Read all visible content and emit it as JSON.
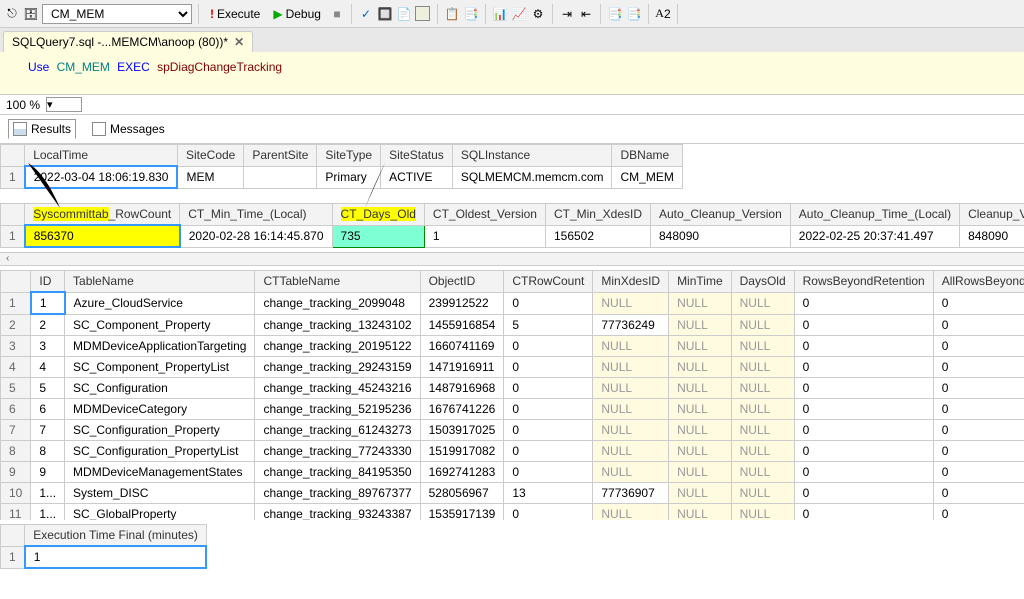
{
  "toolbar": {
    "database": "CM_MEM",
    "execute_label": "Execute",
    "debug_label": "Debug"
  },
  "tab": {
    "title": "SQLQuery7.sql -...MEMCM\\anoop (80))*"
  },
  "editor": {
    "use": "Use",
    "db": "CM_MEM",
    "exec": "EXEC",
    "proc": "spDiagChangeTracking"
  },
  "zoom": {
    "value": "100 %"
  },
  "result_tabs": {
    "results": "Results",
    "messages": "Messages"
  },
  "grid1": {
    "headers": [
      "LocalTime",
      "SiteCode",
      "ParentSite",
      "SiteType",
      "SiteStatus",
      "SQLInstance",
      "DBName"
    ],
    "row_num": "1",
    "row": [
      "2022-03-04 18:06:19.830",
      "MEM",
      "",
      "Primary",
      "ACTIVE",
      "SQLMEMCM.memcm.com",
      "CM_MEM"
    ]
  },
  "grid2": {
    "headers": [
      "Syscommittab_RowCount",
      "CT_Min_Time_(Local)",
      "CT_Days_Old",
      "CT_Oldest_Version",
      "CT_Min_XdesID",
      "Auto_Cleanup_Version",
      "Auto_Cleanup_Time_(Local)",
      "Cleanup_Version"
    ],
    "header_parts": {
      "h0_a": "Syscommittab",
      "h0_b": "_RowCount"
    },
    "row_num": "1",
    "row": [
      "856370",
      "2020-02-28 16:14:45.870",
      "735",
      "1",
      "156502",
      "848090",
      "2022-02-25 20:37:41.497",
      "848090"
    ]
  },
  "grid3": {
    "headers": [
      "ID",
      "TableName",
      "CTTableName",
      "ObjectID",
      "CTRowCount",
      "MinXdesID",
      "MinTime",
      "DaysOld",
      "RowsBeyondRetention",
      "AllRowsBeyondRetention"
    ],
    "rows": [
      {
        "n": "1",
        "id": "1",
        "tn": "Azure_CloudService",
        "ct": "change_tracking_2099048",
        "oid": "239912522",
        "crc": "0",
        "mx": "NULL",
        "mt": "NULL",
        "do": "NULL",
        "rb": "0",
        "ar": "0"
      },
      {
        "n": "2",
        "id": "2",
        "tn": "SC_Component_Property",
        "ct": "change_tracking_13243102",
        "oid": "1455916854",
        "crc": "5",
        "mx": "77736249",
        "mt": "NULL",
        "do": "NULL",
        "rb": "0",
        "ar": "0"
      },
      {
        "n": "3",
        "id": "3",
        "tn": "MDMDeviceApplicationTargeting",
        "ct": "change_tracking_20195122",
        "oid": "1660741169",
        "crc": "0",
        "mx": "NULL",
        "mt": "NULL",
        "do": "NULL",
        "rb": "0",
        "ar": "0"
      },
      {
        "n": "4",
        "id": "4",
        "tn": "SC_Component_PropertyList",
        "ct": "change_tracking_29243159",
        "oid": "1471916911",
        "crc": "0",
        "mx": "NULL",
        "mt": "NULL",
        "do": "NULL",
        "rb": "0",
        "ar": "0"
      },
      {
        "n": "5",
        "id": "5",
        "tn": "SC_Configuration",
        "ct": "change_tracking_45243216",
        "oid": "1487916968",
        "crc": "0",
        "mx": "NULL",
        "mt": "NULL",
        "do": "NULL",
        "rb": "0",
        "ar": "0"
      },
      {
        "n": "6",
        "id": "6",
        "tn": "MDMDeviceCategory",
        "ct": "change_tracking_52195236",
        "oid": "1676741226",
        "crc": "0",
        "mx": "NULL",
        "mt": "NULL",
        "do": "NULL",
        "rb": "0",
        "ar": "0"
      },
      {
        "n": "7",
        "id": "7",
        "tn": "SC_Configuration_Property",
        "ct": "change_tracking_61243273",
        "oid": "1503917025",
        "crc": "0",
        "mx": "NULL",
        "mt": "NULL",
        "do": "NULL",
        "rb": "0",
        "ar": "0"
      },
      {
        "n": "8",
        "id": "8",
        "tn": "SC_Configuration_PropertyList",
        "ct": "change_tracking_77243330",
        "oid": "1519917082",
        "crc": "0",
        "mx": "NULL",
        "mt": "NULL",
        "do": "NULL",
        "rb": "0",
        "ar": "0"
      },
      {
        "n": "9",
        "id": "9",
        "tn": "MDMDeviceManagementStates",
        "ct": "change_tracking_84195350",
        "oid": "1692741283",
        "crc": "0",
        "mx": "NULL",
        "mt": "NULL",
        "do": "NULL",
        "rb": "0",
        "ar": "0"
      },
      {
        "n": "10",
        "id": "1...",
        "tn": "System_DISC",
        "ct": "change_tracking_89767377",
        "oid": "528056967",
        "crc": "13",
        "mx": "77736907",
        "mt": "NULL",
        "do": "NULL",
        "rb": "0",
        "ar": "0"
      },
      {
        "n": "11",
        "id": "1...",
        "tn": "SC_GlobalProperty",
        "ct": "change_tracking_93243387",
        "oid": "1535917139",
        "crc": "0",
        "mx": "NULL",
        "mt": "NULL",
        "do": "NULL",
        "rb": "0",
        "ar": "0"
      }
    ]
  },
  "grid4": {
    "header": "Execution Time Final (minutes)",
    "row_num": "1",
    "value": "1"
  }
}
